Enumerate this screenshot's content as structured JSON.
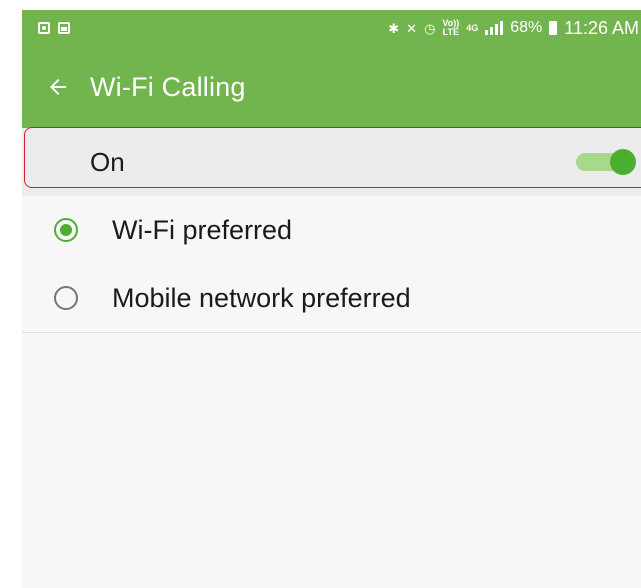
{
  "status_bar": {
    "left_icons": [
      "screen-mirror-icon",
      "gallery-icon"
    ],
    "right_icons": [
      "bluetooth-icon",
      "mute-icon",
      "alarm-icon",
      "volte-icon",
      "4g-icon",
      "signal-icon",
      "battery-icon"
    ],
    "volte_top": "Vo))",
    "volte_bottom": "LTE",
    "network": "4G",
    "battery_percent": "68%",
    "time": "11:26 AM"
  },
  "app_bar": {
    "title": "Wi-Fi Calling",
    "back_icon": "arrow-left-icon"
  },
  "switch": {
    "label": "On",
    "state": "on"
  },
  "options": [
    {
      "label": "Wi-Fi preferred",
      "selected": true
    },
    {
      "label": "Mobile network preferred",
      "selected": false
    }
  ],
  "colors": {
    "primary": "#72b54f",
    "accent": "#4caf32",
    "highlight": "#d0202a"
  }
}
